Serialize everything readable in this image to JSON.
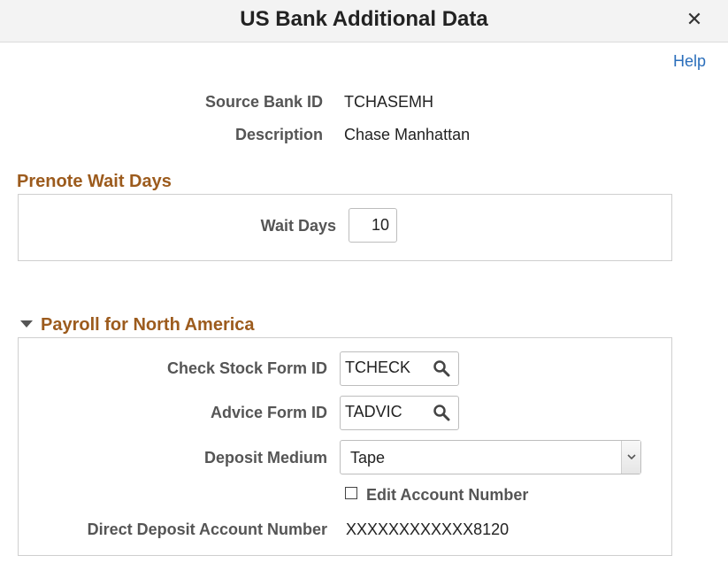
{
  "dialog": {
    "title": "US Bank Additional Data",
    "close_symbol": "✕",
    "help_label": "Help"
  },
  "bank": {
    "source_bank_id_label": "Source Bank ID",
    "source_bank_id_value": "TCHASEMH",
    "description_label": "Description",
    "description_value": "Chase Manhattan"
  },
  "prenote": {
    "section_title": "Prenote Wait Days",
    "wait_days_label": "Wait Days",
    "wait_days_value": "10"
  },
  "payroll": {
    "section_title": "Payroll for North America",
    "check_stock_label": "Check Stock Form ID",
    "check_stock_value": "TCHECK",
    "advice_form_label": "Advice Form ID",
    "advice_form_value": "TADVIC",
    "deposit_medium_label": "Deposit Medium",
    "deposit_medium_value": "Tape",
    "edit_account_label": "Edit Account Number",
    "edit_account_checked": false,
    "direct_deposit_label": "Direct Deposit Account Number",
    "direct_deposit_value": "XXXXXXXXXXXX8120"
  },
  "icons": {
    "close": "close-icon",
    "lookup": "search-icon",
    "dropdown": "chevron-down-icon",
    "collapse": "triangle-down-icon"
  },
  "colors": {
    "section_title": "#9c5b1d",
    "link": "#2a6ebb",
    "titlebar_bg": "#f3f3f3"
  }
}
